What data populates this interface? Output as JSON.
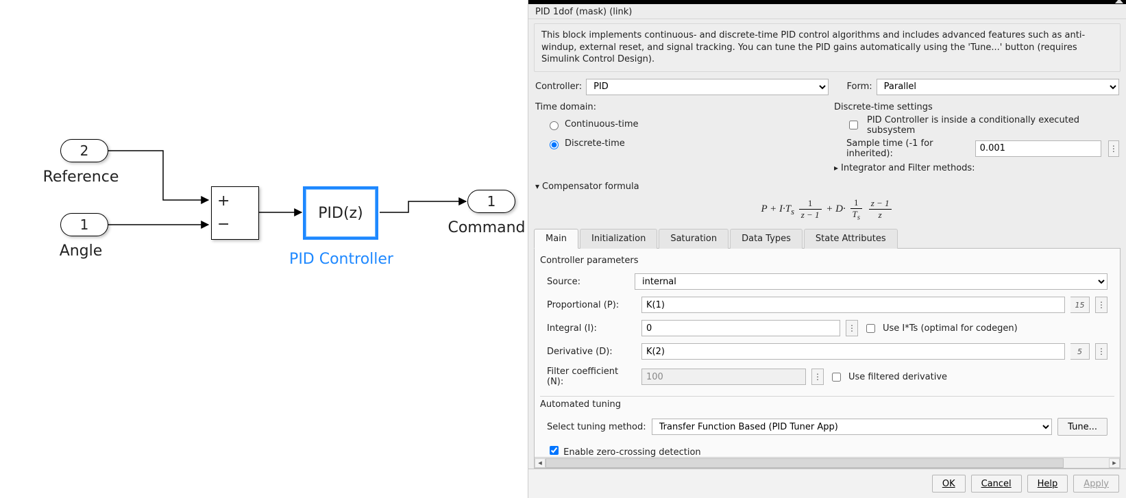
{
  "canvas": {
    "port_reference": {
      "num": "2",
      "label": "Reference"
    },
    "port_angle": {
      "num": "1",
      "label": "Angle"
    },
    "port_command": {
      "num": "1",
      "label": "Command"
    },
    "sum": {
      "sign1": "+",
      "sign2": "−"
    },
    "pid_block": {
      "text": "PID(z)",
      "label": "PID Controller"
    }
  },
  "panel": {
    "mask_title": "PID 1dof (mask) (link)",
    "description": "This block implements continuous- and discrete-time PID control algorithms and includes advanced features such as anti-windup, external reset, and signal tracking. You can tune the PID gains automatically using the 'Tune...' button (requires Simulink Control Design).",
    "controller_label": "Controller:",
    "controller_value": "PID",
    "form_label": "Form:",
    "form_value": "Parallel",
    "time_domain_label": "Time domain:",
    "continuous_label": "Continuous-time",
    "discrete_label": "Discrete-time",
    "discrete_heading": "Discrete-time settings",
    "cond_exec_label": "PID Controller is inside a conditionally executed subsystem",
    "sample_time_label": "Sample time (-1 for inherited):",
    "sample_time_value": "0.001",
    "integrator_expander": "Integrator and Filter methods:",
    "compensator_label": "Compensator formula",
    "tabs": {
      "main": "Main",
      "init": "Initialization",
      "sat": "Saturation",
      "dtypes": "Data Types",
      "state": "State Attributes"
    },
    "controller_params_heading": "Controller parameters",
    "source_label": "Source:",
    "source_value": "internal",
    "p_label": "Proportional (P):",
    "p_value": "K(1)",
    "p_hint": "15",
    "i_label": "Integral (I):",
    "i_value": "0",
    "i_checkbox": "Use I*Ts (optimal for codegen)",
    "d_label": "Derivative (D):",
    "d_value": "K(2)",
    "d_hint": "5",
    "n_label": "Filter coefficient (N):",
    "n_value": "100",
    "n_checkbox": "Use filtered derivative",
    "auto_tuning_heading": "Automated tuning",
    "tuning_method_label": "Select tuning method:",
    "tuning_method_value": "Transfer Function Based (PID Tuner App)",
    "tune_button": "Tune...",
    "zerocross_label": "Enable zero-crossing detection",
    "footer": {
      "ok": "OK",
      "cancel": "Cancel",
      "help": "Help",
      "apply": "Apply"
    }
  }
}
